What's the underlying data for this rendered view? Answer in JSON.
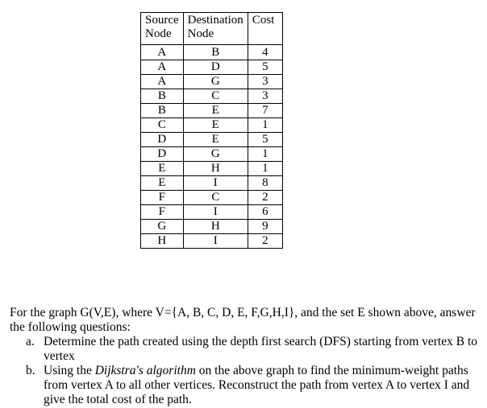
{
  "table": {
    "headers": [
      "Source\nNode",
      "Destination\nNode",
      "Cost"
    ],
    "header_lines": [
      [
        "Source",
        "Node"
      ],
      [
        "Destination",
        "Node"
      ],
      [
        "Cost"
      ]
    ],
    "rows": [
      {
        "source": "A",
        "destination": "B",
        "cost": "4"
      },
      {
        "source": "A",
        "destination": "D",
        "cost": "5"
      },
      {
        "source": "A",
        "destination": "G",
        "cost": "3"
      },
      {
        "source": "B",
        "destination": "C",
        "cost": "3"
      },
      {
        "source": "B",
        "destination": "E",
        "cost": "7"
      },
      {
        "source": "C",
        "destination": "E",
        "cost": "1"
      },
      {
        "source": "D",
        "destination": "E",
        "cost": "5"
      },
      {
        "source": "D",
        "destination": "G",
        "cost": "1"
      },
      {
        "source": "E",
        "destination": "H",
        "cost": "1"
      },
      {
        "source": "E",
        "destination": "I",
        "cost": "8"
      },
      {
        "source": "F",
        "destination": "C",
        "cost": "2"
      },
      {
        "source": "F",
        "destination": "I",
        "cost": "6"
      },
      {
        "source": "G",
        "destination": "H",
        "cost": "9"
      },
      {
        "source": "H",
        "destination": "I",
        "cost": "2"
      }
    ]
  },
  "question": {
    "intro": "For the graph G(V,E), where V={A, B, C, D, E, F,G,H,I}, and the set E shown above, answer the following questions:",
    "items": [
      {
        "marker": "a.",
        "text_before": "Determine the path created using the depth first search (DFS) starting from vertex B to vertex",
        "emphasis": "",
        "text_after": ""
      },
      {
        "marker": "b.",
        "text_before": "Using the ",
        "emphasis": "Dijkstra's algorithm",
        "text_after": " on the above graph to find the minimum-weight paths from vertex A to all other vertices. Reconstruct the path from vertex A to vertex I and give the total cost of the path."
      }
    ]
  }
}
